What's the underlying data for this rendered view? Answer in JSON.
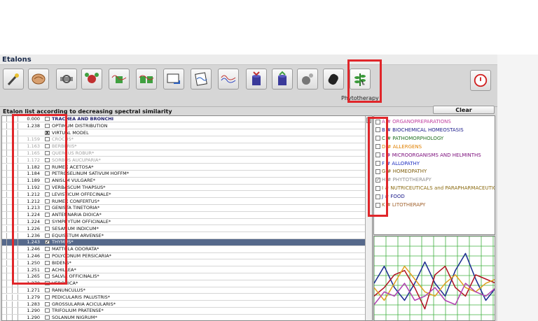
{
  "window": {
    "title": "Etalons"
  },
  "toolbar": {
    "buttons": [
      {
        "name": "wand-icon"
      },
      {
        "name": "brain-icon"
      },
      {
        "name": "pipe-icon"
      },
      {
        "name": "molecule-icon"
      },
      {
        "name": "wave-filter-icon"
      },
      {
        "name": "dual-filter-icon"
      },
      {
        "name": "screen-transfer-icon"
      },
      {
        "name": "paper-wave-icon"
      },
      {
        "name": "spectrum-icon"
      },
      {
        "name": "cylinder-in-icon"
      },
      {
        "name": "cylinder-out-icon"
      },
      {
        "name": "tools-icon"
      },
      {
        "name": "stone-icon"
      },
      {
        "name": "plant-icon"
      }
    ],
    "active_label": "Phytotherapy"
  },
  "list": {
    "title": "Etalon list according to decreasing spectral similarity",
    "rows": [
      {
        "num": "0.000",
        "name": "TRACHEA AND BRONCHI",
        "bold": true,
        "color": "#1a1a6a"
      },
      {
        "num": "1.238",
        "name": "OPTIMUM DISTRIBUTION",
        "color": "#111"
      },
      {
        "num": "",
        "name": "VIRTUAL MODEL",
        "check": "X",
        "color": "#111"
      },
      {
        "num": "1.159",
        "name": "CROCUS*",
        "color": "#a0a0a0"
      },
      {
        "num": "1.163",
        "name": "BERBERIS*",
        "color": "#a0a0a0"
      },
      {
        "num": "1.165",
        "name": "QUERCUS ROBUR*",
        "color": "#a0a0a0"
      },
      {
        "num": "1.172",
        "name": "SORBUS AUCUPARIA*",
        "color": "#a0a0a0"
      },
      {
        "num": "1.182",
        "name": "RUMEX ACETOSA*",
        "color": "#111"
      },
      {
        "num": "1.184",
        "name": "PETROSELINUM SATIVUM HOFFM*",
        "color": "#111"
      },
      {
        "num": "1.189",
        "name": "ANISUM VULGARE*",
        "color": "#111"
      },
      {
        "num": "1.192",
        "name": "VERBASCUM THAPSUS*",
        "color": "#111"
      },
      {
        "num": "1.212",
        "name": "LEVISTICUM OFFECINALE*",
        "color": "#111"
      },
      {
        "num": "1.212",
        "name": "RUMEX CONFERTUS*",
        "color": "#111"
      },
      {
        "num": "1.213",
        "name": "GENISTA TINETORIA*",
        "color": "#111"
      },
      {
        "num": "1.224",
        "name": "ANTENNARIA DIOICA*",
        "color": "#111"
      },
      {
        "num": "1.224",
        "name": "SYMPHYTUM OFFICINALE*",
        "color": "#111"
      },
      {
        "num": "1.226",
        "name": "SESAMUM INDICUM*",
        "color": "#111"
      },
      {
        "num": "1.236",
        "name": "EQUISETUM ARVENSE*",
        "color": "#111"
      },
      {
        "num": "1.243",
        "name": "THYMUS*",
        "check": "✔",
        "sel": true,
        "color": "#fff"
      },
      {
        "num": "1.246",
        "name": "MATTOLA ODORATA*",
        "color": "#111"
      },
      {
        "num": "1.246",
        "name": "POLYGONUM PERSICARIA*",
        "color": "#111"
      },
      {
        "num": "1.250",
        "name": "BIDENS*",
        "color": "#111"
      },
      {
        "num": "1.251",
        "name": "ACHILLEA*",
        "color": "#111"
      },
      {
        "num": "1.265",
        "name": "SALVIA OFFICINALIS*",
        "color": "#111"
      },
      {
        "num": "1.270",
        "name": "VERONICA*",
        "color": "#111"
      },
      {
        "num": "1.271",
        "name": "RANUNCULUS*",
        "color": "#111"
      },
      {
        "num": "1.279",
        "name": "PEDICULARIS PALUSTRIS*",
        "color": "#111"
      },
      {
        "num": "1.283",
        "name": "GROSSULARIA ACICULARIS*",
        "color": "#111"
      },
      {
        "num": "1.290",
        "name": "TRIFOLIUM PRATENSE*",
        "color": "#111"
      },
      {
        "num": "1.290",
        "name": "SOLANUM NIGRUM*",
        "color": "#111"
      }
    ]
  },
  "clear_label": "Clear",
  "categories": [
    {
      "label": "A # ORGANOPREPARATIONS",
      "color": "#c040a0",
      "checked": false
    },
    {
      "label": "B # BIOCHEMICAL HOMEOSTASIS",
      "color": "#1a1a8a",
      "checked": false
    },
    {
      "label": "C # PATHOMORPHOLOGY",
      "color": "#207020",
      "checked": false
    },
    {
      "label": "D # ALLERGENS",
      "color": "#e08000",
      "checked": false
    },
    {
      "label": "E # MICROORGANISMS AND HELMINTHS",
      "color": "#7a0a7a",
      "checked": false
    },
    {
      "label": "F # ALLOPATHY",
      "color": "#2030c0",
      "checked": false
    },
    {
      "label": "G # HOMEOPATHY",
      "color": "#806010",
      "checked": false
    },
    {
      "label": "H # PHYTOTHERAPY",
      "color": "#909090",
      "checked": true
    },
    {
      "label": "I # NUTRICEUTICALS and PARAPHARMACEUTICALS",
      "color": "#8a6a10",
      "checked": false
    },
    {
      "label": "J # FOOD",
      "color": "#1a1a8a",
      "checked": false
    },
    {
      "label": "K # LITOTHERAPY",
      "color": "#a0602a",
      "checked": false
    }
  ],
  "graph": {
    "series": [
      {
        "color": "#1a2a90",
        "values": [
          0.55,
          0.35,
          0.6,
          0.75,
          0.55,
          0.3,
          0.55,
          0.7,
          0.4,
          0.2,
          0.5,
          0.75,
          0.6
        ]
      },
      {
        "color": "#b01020",
        "values": [
          0.7,
          0.6,
          0.45,
          0.4,
          0.6,
          0.85,
          0.45,
          0.35,
          0.6,
          0.7,
          0.45,
          0.5,
          0.55
        ]
      },
      {
        "color": "#e0a020",
        "values": [
          0.6,
          0.75,
          0.55,
          0.35,
          0.5,
          0.65,
          0.7,
          0.55,
          0.45,
          0.6,
          0.65,
          0.55,
          0.5
        ]
      },
      {
        "color": "#b040b0",
        "values": [
          0.8,
          0.65,
          0.7,
          0.55,
          0.75,
          0.7,
          0.6,
          0.75,
          0.8,
          0.55,
          0.65,
          0.7,
          0.6
        ]
      }
    ]
  }
}
